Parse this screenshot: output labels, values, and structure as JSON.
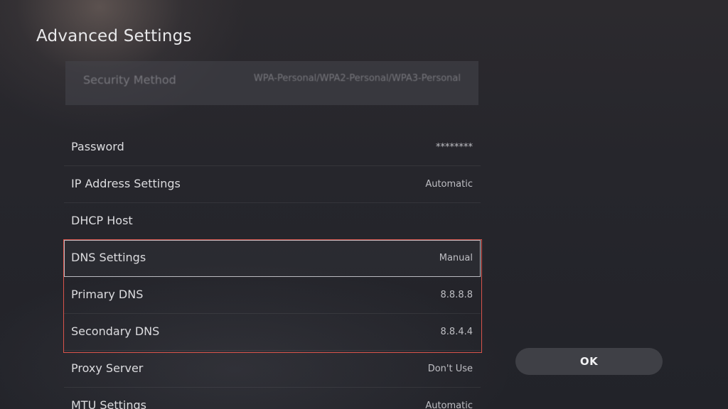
{
  "header": {
    "title": "Advanced Settings"
  },
  "partial_row": {
    "label": "Security Method",
    "value": "WPA-Personal/WPA2-Personal/WPA3-Personal"
  },
  "settings": [
    {
      "label": "Password",
      "value": "********"
    },
    {
      "label": "IP Address Settings",
      "value": "Automatic"
    },
    {
      "label": "DHCP Host",
      "value": ""
    },
    {
      "label": "DNS Settings",
      "value": "Manual"
    },
    {
      "label": "Primary DNS",
      "value": "8.8.8.8"
    },
    {
      "label": "Secondary DNS",
      "value": "8.8.4.4"
    },
    {
      "label": "Proxy Server",
      "value": "Don't Use"
    },
    {
      "label": "MTU Settings",
      "value": "Automatic"
    }
  ],
  "actions": {
    "ok_label": "OK"
  },
  "colors": {
    "highlight_border": "#d9544b",
    "background": "#24252b"
  }
}
